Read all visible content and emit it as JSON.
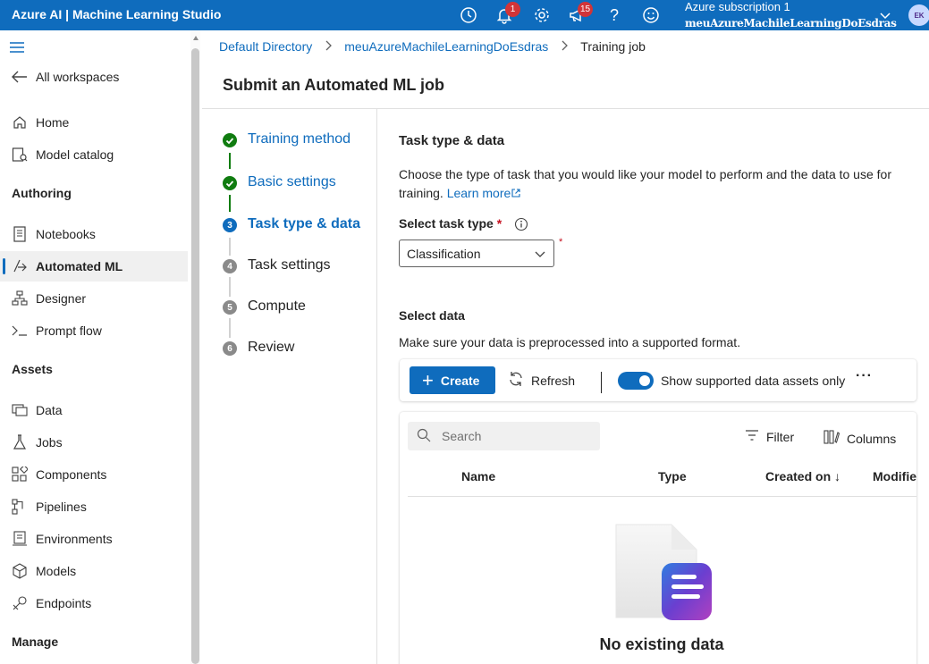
{
  "topbar": {
    "app_title": "Azure AI | Machine Learning Studio",
    "notifications_count": "1",
    "feedback_count": "15",
    "subscription": "Azure subscription 1",
    "workspace": "meuAzureMachileLearningDoEsdras",
    "avatar_initials": "EK",
    "icons": [
      "history-icon",
      "bell-icon",
      "gear-icon",
      "megaphone-icon",
      "help-icon",
      "smiley-icon",
      "chevron-down-icon"
    ]
  },
  "sidebar": {
    "all_workspaces": "All workspaces",
    "top_items": [
      {
        "label": "Home",
        "icon": "home-icon"
      },
      {
        "label": "Model catalog",
        "icon": "catalog-icon"
      }
    ],
    "sections": {
      "authoring": "Authoring",
      "assets": "Assets",
      "manage": "Manage"
    },
    "authoring_items": [
      {
        "label": "Notebooks",
        "icon": "notebook-icon"
      },
      {
        "label": "Automated ML",
        "icon": "automl-icon",
        "active": true
      },
      {
        "label": "Designer",
        "icon": "designer-icon"
      },
      {
        "label": "Prompt flow",
        "icon": "prompt-icon"
      }
    ],
    "asset_items": [
      {
        "label": "Data",
        "icon": "data-icon"
      },
      {
        "label": "Jobs",
        "icon": "jobs-icon"
      },
      {
        "label": "Components",
        "icon": "components-icon"
      },
      {
        "label": "Pipelines",
        "icon": "pipelines-icon"
      },
      {
        "label": "Environments",
        "icon": "environments-icon"
      },
      {
        "label": "Models",
        "icon": "models-icon"
      },
      {
        "label": "Endpoints",
        "icon": "endpoints-icon"
      }
    ]
  },
  "breadcrumb": [
    "Default Directory",
    "meuAzureMachileLearningDoEsdras",
    "Training job"
  ],
  "page_title": "Submit an Automated ML job",
  "steps": [
    {
      "label": "Training method",
      "state": "done",
      "num": ""
    },
    {
      "label": "Basic settings",
      "state": "done",
      "num": ""
    },
    {
      "label": "Task type & data",
      "state": "current",
      "num": "3"
    },
    {
      "label": "Task settings",
      "state": "todo",
      "num": "4"
    },
    {
      "label": "Compute",
      "state": "todo",
      "num": "5"
    },
    {
      "label": "Review",
      "state": "todo",
      "num": "6"
    }
  ],
  "content": {
    "section_title": "Task type & data",
    "description": "Choose the type of task that you would like your model to perform and the data to use for training.",
    "learn_more": "Learn more",
    "task_type_label": "Select task type",
    "required_mark": "*",
    "task_type_value": "Classification",
    "select_data_title": "Select data",
    "select_data_desc": "Make sure your data is preprocessed into a supported format.",
    "create_label": "Create",
    "refresh_label": "Refresh",
    "toggle_label": "Show supported data assets only",
    "toggle_on": true,
    "more_label": "···",
    "search_placeholder": "Search",
    "filter_label": "Filter",
    "columns_label": "Columns",
    "columns": [
      "Name",
      "Type",
      "Created on ↓",
      "Modifie"
    ],
    "empty_title": "No existing data"
  },
  "colors": {
    "brand": "#0f6cbd",
    "success": "#107c10",
    "badge": "#d13438"
  }
}
